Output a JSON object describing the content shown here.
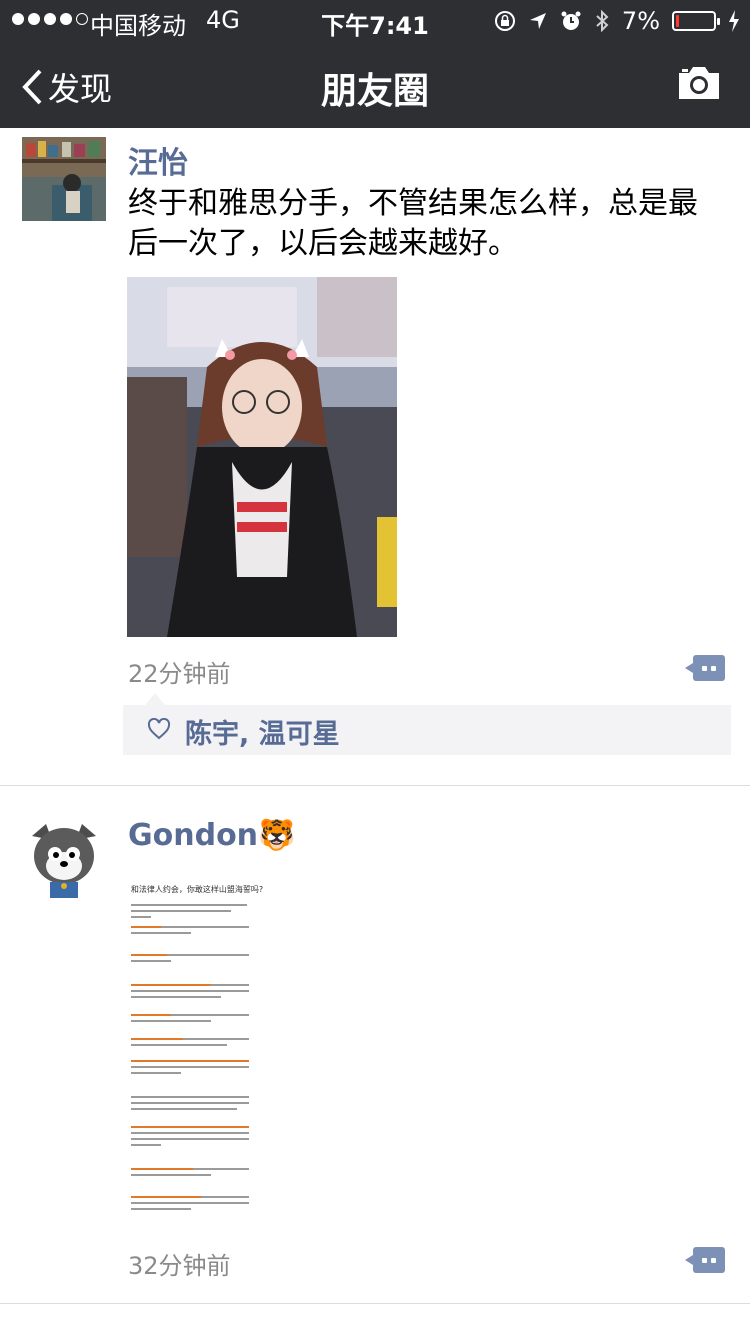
{
  "status_bar": {
    "carrier": "中国移动",
    "network": "4G",
    "time": "下午7:41",
    "battery_percent": "7%",
    "battery_level": 0.07
  },
  "nav": {
    "back_label": "发现",
    "title": "朋友圈"
  },
  "posts": [
    {
      "author": "汪怡",
      "text": "终于和雅思分手，不管结果怎么样，总是最后一次了，以后会越来越好。",
      "time": "22分钟前",
      "likes": "陈宇, 温可星"
    },
    {
      "author": "Gondon🐯",
      "doc_title": "和法律人约会，你敢这样山盟海誓吗?",
      "time": "32分钟前"
    }
  ],
  "colors": {
    "header_bg": "#2e2f33",
    "name_link": "#576b95",
    "like_bg": "#f3f3f5"
  }
}
